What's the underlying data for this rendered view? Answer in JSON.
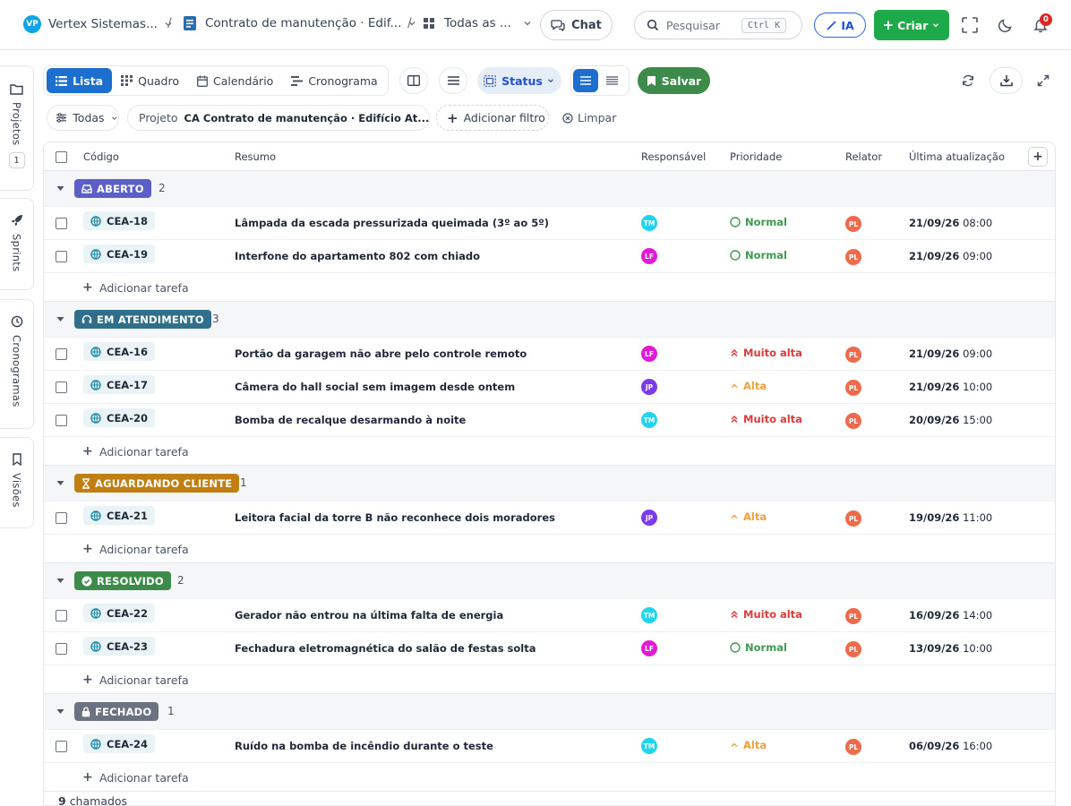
{
  "topbar": {
    "logo": "VP",
    "workspace": "Vertex Sistemas...",
    "project": "Contrato de manutenção · Edif...",
    "view": "Todas as ...",
    "chat": "Chat",
    "search_placeholder": "Pesquisar",
    "shortcut": "Ctrl K",
    "ia": "IA",
    "criar": "Criar",
    "notifications": "0"
  },
  "rail": {
    "projetos": "Projetos",
    "projetos_count": "1",
    "sprints": "Sprints",
    "cronogramas": "Cronogramas",
    "visoes": "Visões"
  },
  "toolbar": {
    "lista": "Lista",
    "quadro": "Quadro",
    "calendario": "Calendário",
    "cronograma": "Cronograma",
    "status": "Status",
    "salvar": "Salvar"
  },
  "filters": {
    "todas": "Todas",
    "projeto_label": "Projeto",
    "projeto_value": "CA Contrato de manutenção · Edifício At...",
    "adicionar": "Adicionar filtro",
    "limpar": "Limpar"
  },
  "columns": {
    "codigo": "Código",
    "resumo": "Resumo",
    "responsavel": "Responsável",
    "prioridade": "Prioridade",
    "relator": "Relator",
    "atualizacao": "Última atualização"
  },
  "groups": [
    {
      "label": "ABERTO",
      "count": "2",
      "color": "#5b5fc7",
      "rows": [
        {
          "code": "CEA-18",
          "summary": "Lâmpada da escada pressurizada queimada (3º ao 5º)",
          "assignee": "TM",
          "assignee_color": "#22d3ee",
          "priority": "Normal",
          "priority_color": "#3f9a52",
          "reporter": "PL",
          "date": "21/09/26",
          "time": "08:00"
        },
        {
          "code": "CEA-19",
          "summary": "Interfone do apartamento 802 com chiado",
          "assignee": "LF",
          "assignee_color": "#e11ad8",
          "priority": "Normal",
          "priority_color": "#3f9a52",
          "reporter": "PL",
          "date": "21/09/26",
          "time": "09:00"
        }
      ],
      "add": "Adicionar tarefa"
    },
    {
      "label": "EM ATENDIMENTO",
      "count": "3",
      "color": "#2f6f8a",
      "rows": [
        {
          "code": "CEA-16",
          "summary": "Portão da garagem não abre pelo controle remoto",
          "assignee": "LF",
          "assignee_color": "#e11ad8",
          "priority": "Muito alta",
          "priority_color": "#dc3b3b",
          "reporter": "PL",
          "date": "21/09/26",
          "time": "09:00"
        },
        {
          "code": "CEA-17",
          "summary": "Câmera do hall social sem imagem desde ontem",
          "assignee": "JP",
          "assignee_color": "#7c3aed",
          "priority": "Alta",
          "priority_color": "#f0a03c",
          "reporter": "PL",
          "date": "21/09/26",
          "time": "10:00"
        },
        {
          "code": "CEA-20",
          "summary": "Bomba de recalque desarmando à noite",
          "assignee": "TM",
          "assignee_color": "#22d3ee",
          "priority": "Muito alta",
          "priority_color": "#dc3b3b",
          "reporter": "PL",
          "date": "20/09/26",
          "time": "15:00"
        }
      ],
      "add": "Adicionar tarefa"
    },
    {
      "label": "AGUARDANDO CLIENTE",
      "count": "1",
      "color": "#c17f12",
      "rows": [
        {
          "code": "CEA-21",
          "summary": "Leitora facial da torre B não reconhece dois moradores",
          "assignee": "JP",
          "assignee_color": "#7c3aed",
          "priority": "Alta",
          "priority_color": "#f0a03c",
          "reporter": "PL",
          "date": "19/09/26",
          "time": "11:00"
        }
      ],
      "add": "Adicionar tarefa"
    },
    {
      "label": "RESOLVIDO",
      "count": "2",
      "color": "#3d8b4a",
      "rows": [
        {
          "code": "CEA-22",
          "summary": "Gerador não entrou na última falta de energia",
          "assignee": "TM",
          "assignee_color": "#22d3ee",
          "priority": "Muito alta",
          "priority_color": "#dc3b3b",
          "reporter": "PL",
          "date": "16/09/26",
          "time": "14:00"
        },
        {
          "code": "CEA-23",
          "summary": "Fechadura eletromagnética do salão de festas solta",
          "assignee": "LF",
          "assignee_color": "#e11ad8",
          "priority": "Normal",
          "priority_color": "#3f9a52",
          "reporter": "PL",
          "date": "13/09/26",
          "time": "10:00"
        }
      ],
      "add": "Adicionar tarefa"
    },
    {
      "label": "FECHADO",
      "count": "1",
      "color": "#6b7280",
      "rows": [
        {
          "code": "CEA-24",
          "summary": "Ruído na bomba de incêndio durante o teste",
          "assignee": "TM",
          "assignee_color": "#22d3ee",
          "priority": "Alta",
          "priority_color": "#f0a03c",
          "reporter": "PL",
          "date": "06/09/26",
          "time": "16:00"
        }
      ],
      "add": "Adicionar tarefa"
    }
  ],
  "footer": {
    "count": "9",
    "label": "chamados"
  },
  "colors": {
    "accent": "#1d6fcf",
    "primary_green": "#1ea94a",
    "reporter": "#ee6a4c"
  }
}
